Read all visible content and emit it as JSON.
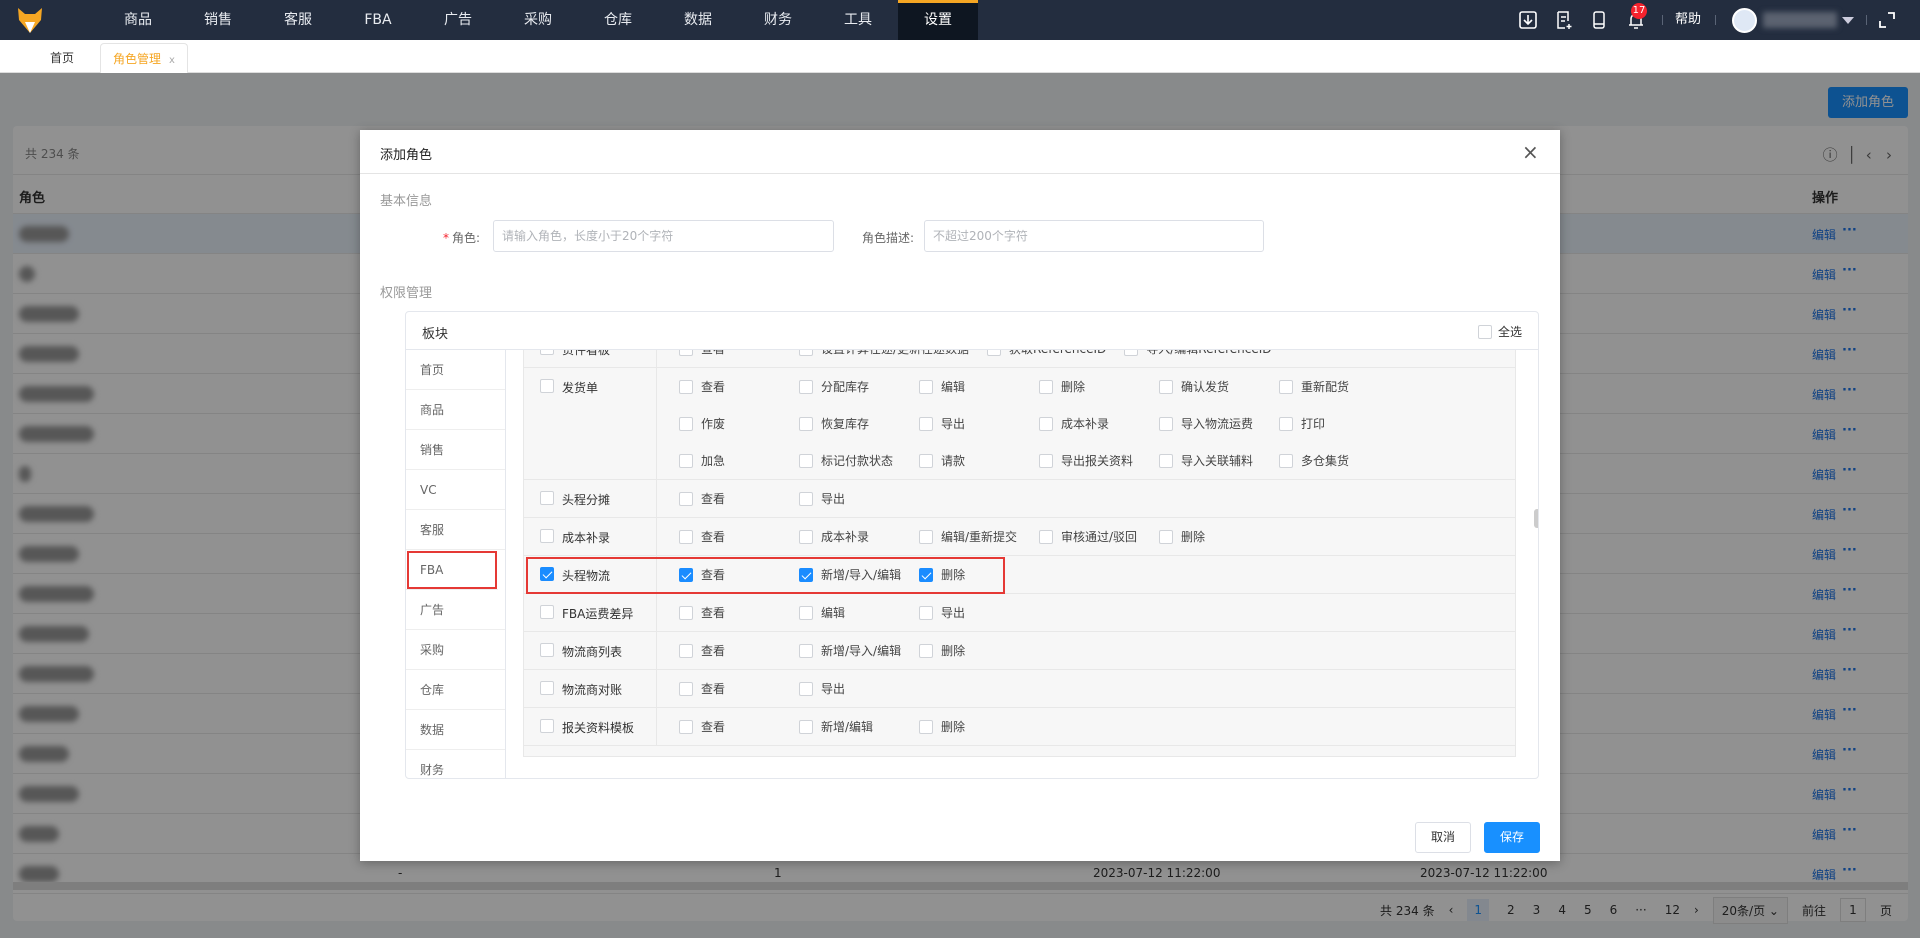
{
  "nav": {
    "items": [
      "商品",
      "销售",
      "客服",
      "FBA",
      "广告",
      "采购",
      "仓库",
      "数据",
      "财务",
      "工具",
      "设置"
    ],
    "active": "设置",
    "help": "帮助",
    "notification_count": "17",
    "accent": "#f5a623"
  },
  "tabs": [
    {
      "label": "首页"
    },
    {
      "label": "角色管理",
      "close": "x"
    }
  ],
  "page": {
    "add_role": "添加角色",
    "total": "共 234 条",
    "col_role": "角色",
    "col_op": "操作",
    "edit": "编辑",
    "more": "···",
    "last_row": {
      "c1": "-",
      "c2": "1",
      "c3": "2023-07-12 11:22:00",
      "c4": "2023-07-12 11:22:00"
    },
    "pager": {
      "total": "共 234 条",
      "prev": "‹",
      "pages": [
        "1",
        "2",
        "3",
        "4",
        "5",
        "6",
        "···",
        "12"
      ],
      "next": "›",
      "size": "20条/页 ⌄",
      "goto": "前往",
      "goto_value": "1",
      "page_unit": "页"
    }
  },
  "modal": {
    "title": "添加角色",
    "close": "×",
    "basic": "基本信息",
    "role_label": "角色:",
    "role_placeholder": "请输入角色，长度小于20个字符",
    "desc_label": "角色描述:",
    "desc_placeholder": "不超过200个字符",
    "perm": "权限管理",
    "block": "板块",
    "select_all": "全选",
    "cancel": "取消",
    "save": "保存",
    "modules": [
      "首页",
      "商品",
      "销售",
      "VC",
      "客服",
      "FBA",
      "广告",
      "采购",
      "仓库",
      "数据",
      "财务"
    ],
    "selected_module": "FBA",
    "rows": [
      {
        "name": "货件看板",
        "checked": false,
        "opts": [
          [
            "查看",
            false
          ],
          [
            "设置计算在途/更新在途数据",
            false
          ],
          [
            "获取ReferenceID",
            false
          ],
          [
            "导入/编辑ReferenceID",
            false
          ]
        ]
      },
      {
        "name": "发货单",
        "checked": false,
        "opts": [
          [
            "查看",
            false
          ],
          [
            "分配库存",
            false
          ],
          [
            "编辑",
            false
          ],
          [
            "删除",
            false
          ],
          [
            "确认发货",
            false
          ],
          [
            "重新配货",
            false
          ],
          [
            "作废",
            false
          ],
          [
            "恢复库存",
            false
          ],
          [
            "导出",
            false
          ],
          [
            "成本补录",
            false
          ],
          [
            "导入物流运费",
            false
          ],
          [
            "打印",
            false
          ],
          [
            "加急",
            false
          ],
          [
            "标记付款状态",
            false
          ],
          [
            "请款",
            false
          ],
          [
            "导出报关资料",
            false
          ],
          [
            "导入关联辅料",
            false
          ],
          [
            "多仓集货",
            false
          ]
        ]
      },
      {
        "name": "头程分摊",
        "checked": false,
        "opts": [
          [
            "查看",
            false
          ],
          [
            "导出",
            false
          ]
        ]
      },
      {
        "name": "成本补录",
        "checked": false,
        "opts": [
          [
            "查看",
            false
          ],
          [
            "成本补录",
            false
          ],
          [
            "编辑/重新提交",
            false
          ],
          [
            "审核通过/驳回",
            false
          ],
          [
            "删除",
            false
          ]
        ]
      },
      {
        "name": "头程物流",
        "checked": true,
        "highlight": true,
        "opts": [
          [
            "查看",
            true
          ],
          [
            "新增/导入/编辑",
            true
          ],
          [
            "删除",
            true
          ]
        ]
      },
      {
        "name": "FBA运费差异",
        "checked": false,
        "opts": [
          [
            "查看",
            false
          ],
          [
            "编辑",
            false
          ],
          [
            "导出",
            false
          ]
        ]
      },
      {
        "name": "物流商列表",
        "checked": false,
        "opts": [
          [
            "查看",
            false
          ],
          [
            "新增/导入/编辑",
            false
          ],
          [
            "删除",
            false
          ]
        ]
      },
      {
        "name": "物流商对账",
        "checked": false,
        "opts": [
          [
            "查看",
            false
          ],
          [
            "导出",
            false
          ]
        ]
      },
      {
        "name": "报关资料模板",
        "checked": false,
        "opts": [
          [
            "查看",
            false
          ],
          [
            "新增/编辑",
            false
          ],
          [
            "删除",
            false
          ]
        ]
      }
    ]
  }
}
